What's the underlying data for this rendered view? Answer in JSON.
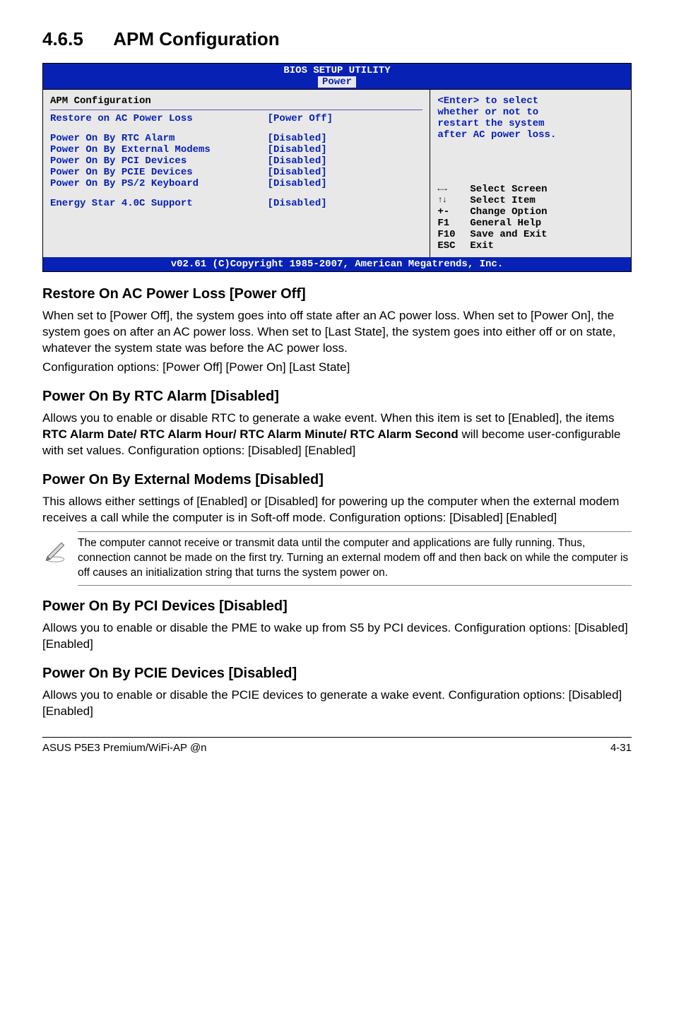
{
  "section": {
    "number": "4.6.5",
    "title": "APM Configuration"
  },
  "bios": {
    "header_title": "BIOS SETUP UTILITY",
    "tab": "Power",
    "panel_title": "APM Configuration",
    "rows": [
      {
        "label": "Restore on AC Power Loss",
        "value": "[Power Off]"
      },
      {
        "label": "Power On By RTC Alarm",
        "value": "[Disabled]"
      },
      {
        "label": "Power On By External Modems",
        "value": "[Disabled]"
      },
      {
        "label": "Power On By PCI Devices",
        "value": "[Disabled]"
      },
      {
        "label": "Power On By PCIE Devices",
        "value": "[Disabled]"
      },
      {
        "label": "Power On By PS/2 Keyboard",
        "value": "[Disabled]"
      },
      {
        "label": "Energy Star 4.0C Support",
        "value": "[Disabled]"
      }
    ],
    "help_text_1": "<Enter> to select",
    "help_text_2": "whether or not to",
    "help_text_3": "restart the system",
    "help_text_4": "after AC power loss.",
    "keys": [
      {
        "k": "←→",
        "d": "Select Screen"
      },
      {
        "k": "↑↓",
        "d": "Select Item"
      },
      {
        "k": "+-",
        "d": "Change Option"
      },
      {
        "k": "F1",
        "d": "General Help"
      },
      {
        "k": "F10",
        "d": "Save and Exit"
      },
      {
        "k": "ESC",
        "d": "Exit"
      }
    ],
    "footer": "v02.61 (C)Copyright 1985-2007, American Megatrends, Inc."
  },
  "topics": {
    "restore": {
      "heading": "Restore On AC Power Loss [Power Off]",
      "p1": "When set to [Power Off], the system goes into off state after an AC power loss. When set to [Power On], the system goes on after an AC power loss. When set to [Last State], the system goes into either off or on state, whatever the system state was before the AC power loss.",
      "p2": "Configuration options: [Power Off] [Power On] [Last State]"
    },
    "rtc": {
      "heading": "Power On By RTC Alarm [Disabled]",
      "p1a": "Allows you to enable or disable RTC to generate a wake event. When this item is set to [Enabled], the items ",
      "p1b": "RTC Alarm Date/ RTC Alarm Hour/ RTC Alarm Minute/ RTC Alarm Second",
      "p1c": " will become user-configurable with set values. Configuration options: [Disabled] [Enabled]"
    },
    "ext_modem": {
      "heading": "Power On By External Modems [Disabled]",
      "p1": "This allows either settings of [Enabled] or [Disabled] for powering up the computer when the external modem receives a call while the computer is in Soft-off mode. Configuration options: [Disabled] [Enabled]",
      "note": "The computer cannot receive or transmit data until the computer and applications are fully running. Thus, connection cannot be made on the first try. Turning an external modem off and then back on while the computer is off causes an initialization string that turns the system power on."
    },
    "pci": {
      "heading": "Power On By PCI Devices [Disabled]",
      "p1": "Allows you to enable or disable the PME to wake up from S5 by PCI devices. Configuration options: [Disabled] [Enabled]"
    },
    "pcie": {
      "heading": "Power On By PCIE Devices [Disabled]",
      "p1": "Allows you to enable or disable the PCIE devices to generate a wake event. Configuration options: [Disabled] [Enabled]"
    }
  },
  "footer": {
    "left": "ASUS P5E3 Premium/WiFi-AP @n",
    "right": "4-31"
  }
}
